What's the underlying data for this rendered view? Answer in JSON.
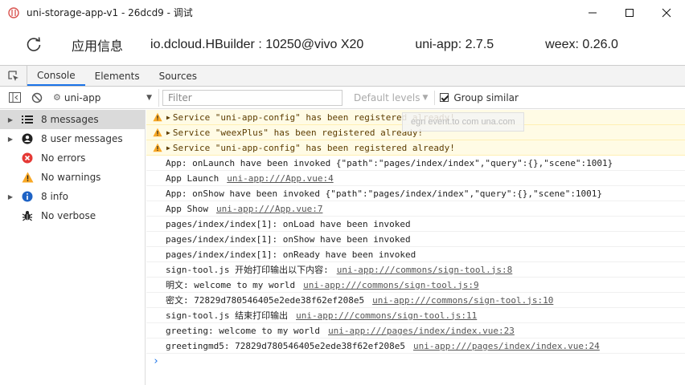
{
  "window": {
    "title": "uni-storage-app-v1 - 26dcd9 - 调试",
    "minimize": "—",
    "maximize": "☐",
    "close": "✕"
  },
  "infobar": {
    "app_info": "应用信息",
    "builder": "io.dcloud.HBuilder : 10250@vivo X20",
    "uniapp": "uni-app: 2.7.5",
    "weex": "weex: 0.26.0"
  },
  "tabs": [
    {
      "label": "Console",
      "active": true
    },
    {
      "label": "Elements",
      "active": false
    },
    {
      "label": "Sources",
      "active": false
    }
  ],
  "toolbar": {
    "context": "uni-app",
    "filter_placeholder": "Filter",
    "levels": "Default levels",
    "group_similar": "Group similar",
    "group_similar_checked": true
  },
  "sidebar": {
    "items": [
      {
        "label": "8 messages",
        "icon": "list-icon",
        "expandable": true,
        "selected": true
      },
      {
        "label": "8 user messages",
        "icon": "user-icon",
        "expandable": true,
        "selected": false
      },
      {
        "label": "No errors",
        "icon": "error-icon",
        "expandable": false,
        "selected": false
      },
      {
        "label": "No warnings",
        "icon": "warning-icon",
        "expandable": false,
        "selected": false
      },
      {
        "label": "8 info",
        "icon": "info-icon",
        "expandable": true,
        "selected": false
      },
      {
        "label": "No verbose",
        "icon": "bug-icon",
        "expandable": false,
        "selected": false
      }
    ]
  },
  "console": {
    "warnings": [
      "Service \"uni-app-config\" has been registered already!",
      "Service \"weexPlus\" has been registered already!",
      "Service \"uni-app-config\" has been registered already!"
    ],
    "logs": [
      {
        "text": "App: onLaunch have been invoked {\"path\":\"pages/index/index\",\"query\":{},\"scene\":1001}",
        "source": ""
      },
      {
        "text": "App Launch",
        "source": "uni-app:///App.vue:4"
      },
      {
        "text": "App: onShow have been invoked {\"path\":\"pages/index/index\",\"query\":{},\"scene\":1001}",
        "source": ""
      },
      {
        "text": "App Show",
        "source": "uni-app:///App.vue:7"
      },
      {
        "text": "pages/index/index[1]: onLoad have been invoked",
        "source": ""
      },
      {
        "text": "pages/index/index[1]: onShow have been invoked",
        "source": ""
      },
      {
        "text": "pages/index/index[1]: onReady have been invoked",
        "source": ""
      },
      {
        "text": "sign-tool.js 开始打印输出以下内容:",
        "source": "uni-app:///commons/sign-tool.js:8"
      },
      {
        "text": "明文: welcome to my world",
        "source": "uni-app:///commons/sign-tool.js:9"
      },
      {
        "text": "密文: 72829d780546405e2ede38f62ef208e5",
        "source": "uni-app:///commons/sign-tool.js:10"
      },
      {
        "text": "sign-tool.js 结束打印输出",
        "source": "uni-app:///commons/sign-tool.js:11"
      },
      {
        "text": "greeting: welcome to my world",
        "source": "uni-app:///pages/index/index.vue:23"
      },
      {
        "text": "greetingmd5: 72829d780546405e2ede38f62ef208e5",
        "source": "uni-app:///pages/index/index.vue:24"
      }
    ],
    "prompt": "›",
    "tooltip": "egn event.to com una.com"
  },
  "colors": {
    "warn_bg": "#fffbe5",
    "accent": "#1a73e8",
    "error": "#e53935",
    "warning": "#f9a825",
    "info": "#1e63c5"
  }
}
